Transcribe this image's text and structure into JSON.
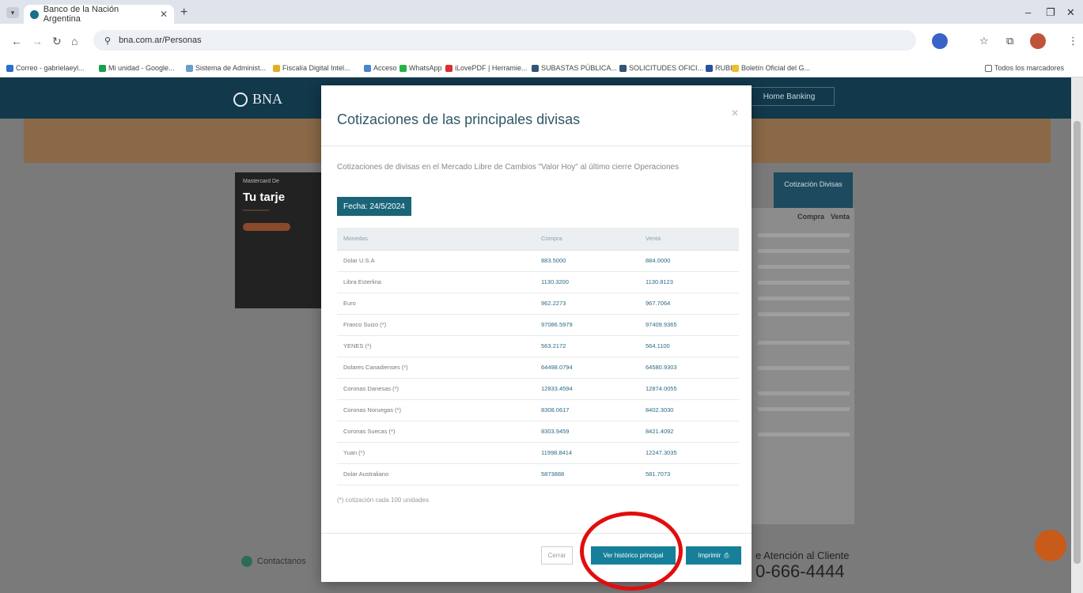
{
  "browser": {
    "tab_title": "Banco de la Nación Argentina",
    "url": "bna.com.ar/Personas",
    "bookmarks": [
      "Correo - gabrielaeyl...",
      "Mi unidad - Google...",
      "Sistema de Administ...",
      "Fiscalía Digital Intel...",
      "Acceso",
      "WhatsApp",
      "iLovePDF | Herramie...",
      "SUBASTAS PÚBLICA...",
      "SOLICITUDES OFICI...",
      "RUBI",
      "Boletín Oficial del G..."
    ],
    "all_bookmarks": "Todos los marcadores"
  },
  "site": {
    "logo": "BNA",
    "home_banking": "Home Banking",
    "ad_small": "Mastercard De",
    "ad_title": "Tu tarje",
    "side_tab": "Cotización Divisas",
    "side_compra": "Compra",
    "side_venta": "Venta",
    "footer_contact": "Contactanos",
    "footer_attention": "e Atención al Cliente",
    "footer_phone": "0-666-4444"
  },
  "modal": {
    "title": "Cotizaciones de las principales divisas",
    "description": "Cotizaciones de divisas en el Mercado Libre de Cambios \"Valor Hoy\" al último cierre Operaciones",
    "date_label": "Fecha: 24/5/2024",
    "columns": [
      "Monedas",
      "Compra",
      "Venta"
    ],
    "rows": [
      {
        "moneda": "Dolar U.S.A",
        "compra": "883.5000",
        "venta": "884.0000"
      },
      {
        "moneda": "Libra Esterlina",
        "compra": "1130.3200",
        "venta": "1130.8123"
      },
      {
        "moneda": "Euro",
        "compra": "962.2273",
        "venta": "967.7064"
      },
      {
        "moneda": "Franco Suizo (*)",
        "compra": "97086.5979",
        "venta": "97409.9365"
      },
      {
        "moneda": "YENES (*)",
        "compra": "563.2172",
        "venta": "564.1100"
      },
      {
        "moneda": "Dolares Canadienses (*)",
        "compra": "64498.0794",
        "venta": "64580.9303"
      },
      {
        "moneda": "Coronas Danesas (*)",
        "compra": "12833.4594",
        "venta": "12874.0055"
      },
      {
        "moneda": "Coronas Noruegas (*)",
        "compra": "8308.0617",
        "venta": "8402.3030"
      },
      {
        "moneda": "Coronas Suecas (*)",
        "compra": "8303.9459",
        "venta": "8421.4092"
      },
      {
        "moneda": "Yuan (*)",
        "compra": "11998.8414",
        "venta": "12247.3035"
      },
      {
        "moneda": "Dolar Australiano",
        "compra": "5873888",
        "venta": "581.7073"
      }
    ],
    "footnote": "(*) cotización cada 100 unidades",
    "buttons": {
      "close": "Cerrar",
      "history": "Ver histórico principal",
      "print": "Imprimir"
    }
  },
  "colors": {
    "primary": "#167f99",
    "header": "#12384b",
    "annotation": "#e20d0d"
  }
}
